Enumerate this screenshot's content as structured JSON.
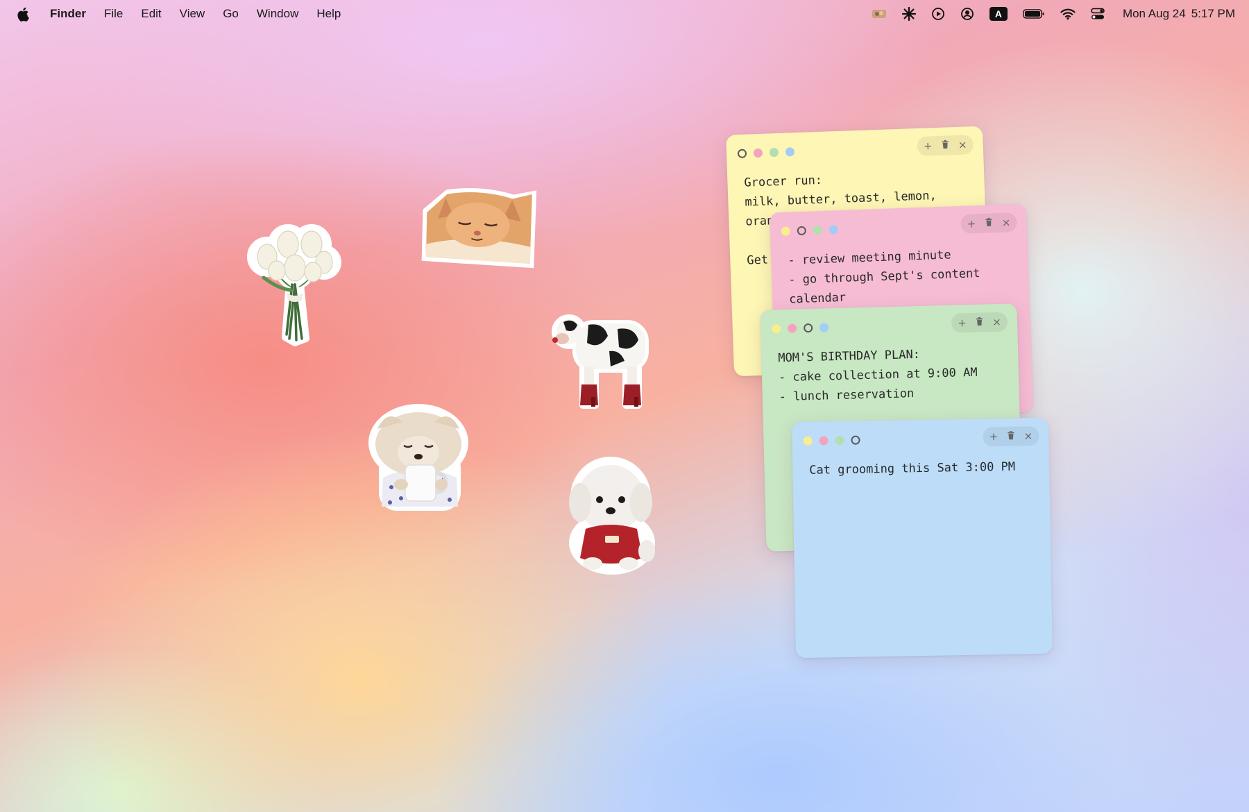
{
  "menubar": {
    "apple_icon": "apple-logo-icon",
    "app_name": "Finder",
    "menus": [
      "File",
      "Edit",
      "View",
      "Go",
      "Window",
      "Help"
    ],
    "status_icons": [
      "app-thumbnail-icon",
      "sparkle-icon",
      "play-circle-icon",
      "user-circle-icon",
      "keyboard-input-icon",
      "battery-icon",
      "wifi-icon",
      "control-center-icon"
    ],
    "input_source_letter": "A",
    "date": "Mon Aug 24",
    "time": "5:17 PM"
  },
  "desktop": {
    "stickers": [
      "tulip-bouquet",
      "sleepy-orange-cat",
      "cow-in-red-boots",
      "chihuahua-with-mug",
      "white-puppy-in-red-sweater"
    ]
  },
  "notes": [
    {
      "color": "#fdf6b4",
      "selected_dot": "yellow",
      "text": "Grocer run:\nmilk, butter, toast, lemon, oranges\n\nGet"
    },
    {
      "color": "#f6bcd3",
      "selected_dot": "pink",
      "text": "- review meeting minute\n- go through Sept's content\ncalendar"
    },
    {
      "color": "#c8e7c3",
      "selected_dot": "green",
      "text": "MOM'S BIRTHDAY PLAN:\n- cake collection at 9:00 AM\n- lunch reservation"
    },
    {
      "color": "#bcdcf8",
      "selected_dot": "blue",
      "text": "Cat grooming this Sat 3:00 PM"
    }
  ],
  "note_tools": {
    "add_glyph": "+",
    "trash_icon": "trash-icon",
    "close_glyph": "×"
  },
  "dot_colors": {
    "yellow": "#f9ee8e",
    "pink": "#f4a3bf",
    "green": "#b3dfae",
    "blue": "#a3cdf6"
  }
}
